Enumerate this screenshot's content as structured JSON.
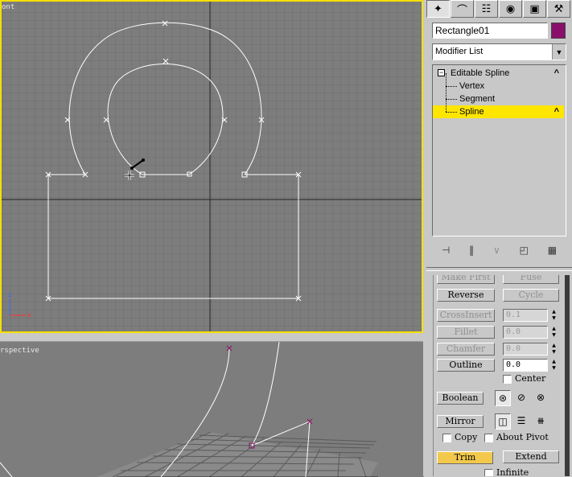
{
  "viewports": {
    "front_label": "ont",
    "persp_label": "rspective"
  },
  "command_panel": {
    "tabs": [
      {
        "name": "create",
        "icon": "create-pointer-icon"
      },
      {
        "name": "modify",
        "icon": "modify-arc-icon"
      },
      {
        "name": "hierarchy",
        "icon": "hierarchy-icon"
      },
      {
        "name": "motion",
        "icon": "motion-icon"
      },
      {
        "name": "display",
        "icon": "display-icon"
      },
      {
        "name": "utilities",
        "icon": "utilities-hammer-icon"
      }
    ],
    "object_name": "Rectangle01",
    "object_color": "#8a0f6b",
    "modifier_list": "Modifier List",
    "stack": {
      "root": "Editable Spline",
      "items": [
        "Vertex",
        "Segment",
        "Spline"
      ],
      "selected": "Spline"
    }
  },
  "geometry_rollout": {
    "make_first_label": "Make First",
    "fuse_label": "Fuse",
    "reverse_label": "Reverse",
    "cycle_label": "Cycle",
    "crossinsert_label": "CrossInsert",
    "crossinsert_value": "0.1",
    "fillet_label": "Fillet",
    "fillet_value": "0.0",
    "chamfer_label": "Chamfer",
    "chamfer_value": "0.0",
    "outline_label": "Outline",
    "outline_value": "0.0",
    "center_label": "Center",
    "boolean_label": "Boolean",
    "mirror_label": "Mirror",
    "copy_label": "Copy",
    "about_pivot_label": "About Pivot",
    "trim_label": "Trim",
    "extend_label": "Extend",
    "infinite_label": "Infinite"
  },
  "colors": {
    "active_viewport_border": "#f5e000",
    "selection_highlight": "#ffe600",
    "trim_active": "#f2c94c"
  }
}
